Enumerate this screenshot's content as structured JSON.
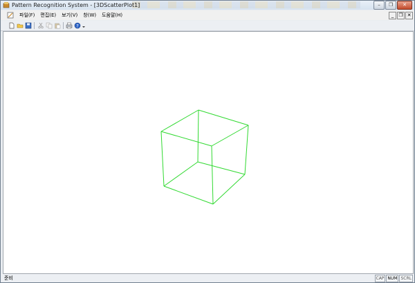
{
  "window": {
    "title": "Pattern Recognition System - [3DScatterPlot1]"
  },
  "menu": {
    "items": [
      "파일(F)",
      "편집(E)",
      "보기(V)",
      "창(W)",
      "도움말(H)"
    ]
  },
  "toolbar": {
    "icons": [
      "new-file-icon",
      "open-folder-icon",
      "save-icon",
      "cut-icon",
      "copy-icon",
      "paste-icon",
      "print-icon",
      "help-icon"
    ]
  },
  "colors": {
    "cube_stroke": "#2fd92f",
    "title_bar": "#dce6f1",
    "close_button": "#c24b2c"
  },
  "status": {
    "text": "준비",
    "indicators": [
      "CAP",
      "NUM",
      "SCRL"
    ]
  }
}
